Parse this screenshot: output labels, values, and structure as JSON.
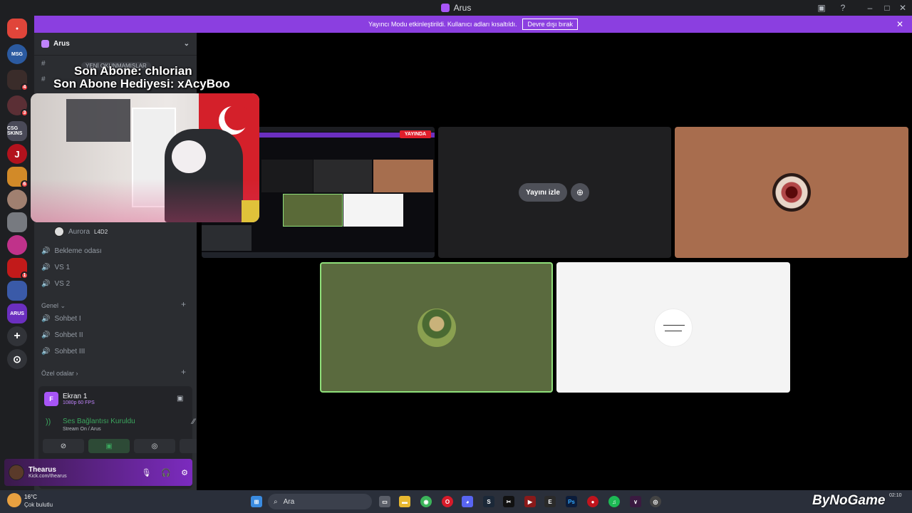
{
  "window": {
    "title": "Arus"
  },
  "banner": {
    "message": "Yayıncı Modu etkinleştirildi. Kullanıcı adları kısaltıldı.",
    "button_label": "Devre dışı bırak",
    "close": "✕"
  },
  "rail": {
    "items": [
      {
        "name": "discord-home",
        "label": "",
        "color": "#e0453a",
        "badge": ""
      },
      {
        "name": "server-messages",
        "label": "MSG",
        "color": "#2b5aa0",
        "badge": ""
      },
      {
        "name": "server-2",
        "label": "",
        "color": "#3a2c2a",
        "badge": "4"
      },
      {
        "name": "server-3",
        "label": "",
        "color": "#5b2f35",
        "badge": "3"
      },
      {
        "name": "server-csgo-skins",
        "label": "CSG SKINS",
        "color": "#4a4a58",
        "badge": ""
      },
      {
        "name": "server-j",
        "label": "J",
        "color": "#b3121d",
        "badge": ""
      },
      {
        "name": "server-6",
        "label": "",
        "color": "#d28a28",
        "badge": "6"
      },
      {
        "name": "server-7",
        "label": "",
        "color": "#a08070",
        "badge": ""
      },
      {
        "name": "server-8",
        "label": "",
        "color": "#777a80",
        "badge": ""
      },
      {
        "name": "server-9",
        "label": "",
        "color": "#c0328a",
        "badge": ""
      },
      {
        "name": "server-10",
        "label": "",
        "color": "#c21a1a",
        "badge": "1"
      },
      {
        "name": "server-11",
        "label": "",
        "color": "#3a5aa8",
        "badge": ""
      },
      {
        "name": "server-arus",
        "label": "ARUS",
        "color": "#6b2fbf",
        "badge": ""
      }
    ],
    "add_icon": "+",
    "explore_icon": "⊙"
  },
  "sidebar": {
    "guild_name": "Arus",
    "overlay_tag": "YENİ OKUNMAMIŞLAR",
    "voice_user": {
      "name": "Aurora",
      "tag": "L4D2"
    },
    "voice_channels_top": [
      "Bekleme odası",
      "VS 1",
      "VS 2"
    ],
    "category_genel": "Genel",
    "voice_channels_genel": [
      "Sohbet I",
      "Sohbet II",
      "Sohbet III"
    ],
    "category_ozel": "Özel odalar"
  },
  "voice_panel": {
    "ekran_title": "Ekran 1",
    "ekran_quality": "1080p 60 FPS",
    "ekran_letter": "F",
    "connection_status": "Ses Bağlantısı Kuruldu",
    "connection_detail": "Stream On / Arus"
  },
  "user": {
    "name": "Thearus",
    "status": "Kick.com/thearus"
  },
  "overlay": {
    "sub_line1": "Son Abone: chlorian",
    "sub_line2": "Son Abone Hediyesi: xAcyBoo"
  },
  "main": {
    "live_badge": "YAYINDA",
    "watch_button": "Yayını izle"
  },
  "taskbar": {
    "weather_temp": "16°C",
    "weather_desc": "Çok bulutlu",
    "search_placeholder": "Ara",
    "clock_time": "02:10",
    "watermark": "ByNoGame"
  },
  "colors": {
    "accent": "#8b3fe0",
    "sidebar_bg": "#2b2d31",
    "rail_bg": "#1e1f22",
    "speaking_green": "#3ba55d"
  }
}
